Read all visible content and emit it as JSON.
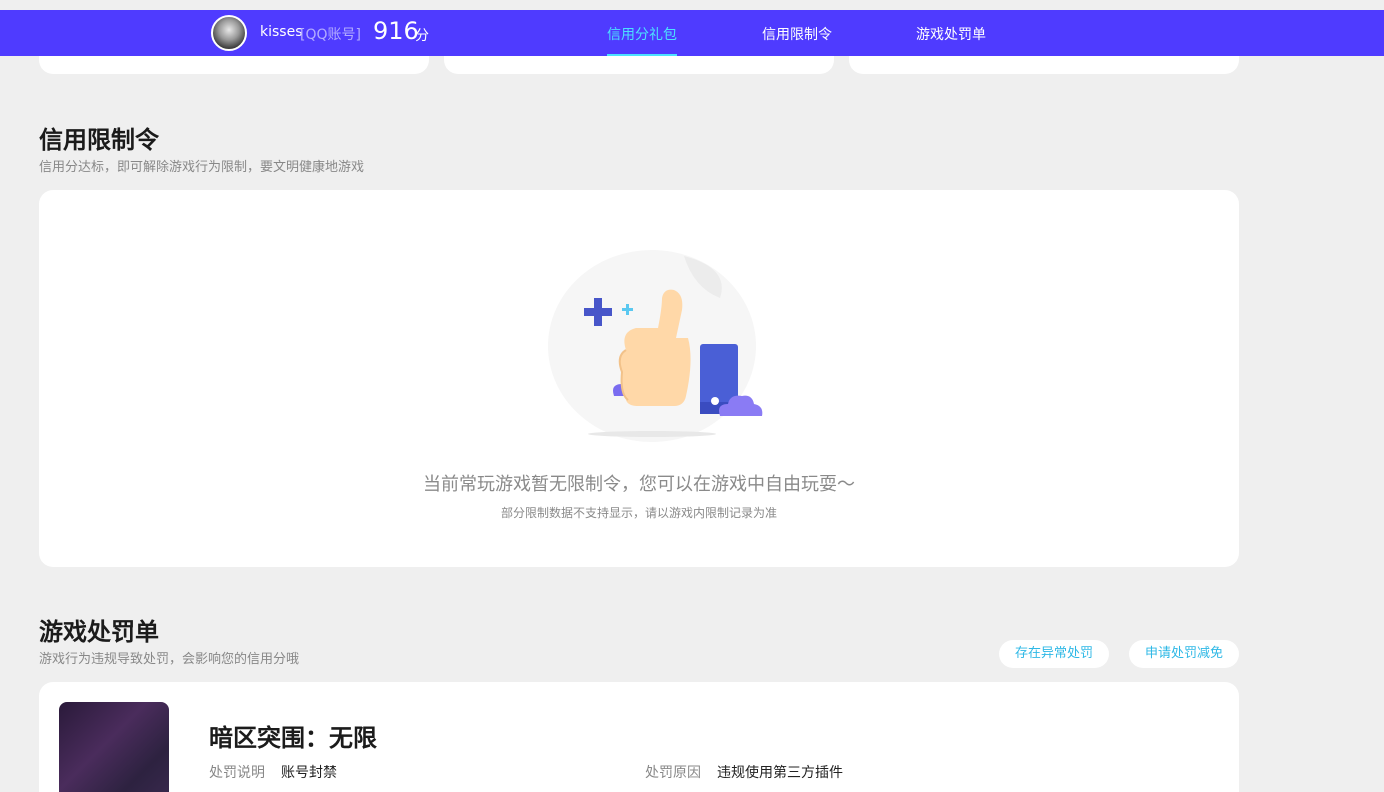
{
  "topbar": {
    "username": "kisses",
    "account_type": "[QQ账号]",
    "score": "916",
    "score_unit": "分",
    "tabs": [
      {
        "label": "信用分礼包",
        "active": true
      },
      {
        "label": "信用限制令",
        "active": false
      },
      {
        "label": "游戏处罚单",
        "active": false
      }
    ],
    "accent": "#4f3bff",
    "active_tab_color": "#4ce1ff"
  },
  "restriction": {
    "title": "信用限制令",
    "subtitle": "信用分达标，即可解除游戏行为限制，要文明健康地游戏",
    "empty_message": "当前常玩游戏暂无限制令，您可以在游戏中自由玩耍～",
    "empty_note": "部分限制数据不支持显示，请以游戏内限制记录为准",
    "illustration_icon": "thumbs-up-icon"
  },
  "penalty": {
    "title": "游戏处罚单",
    "subtitle": "游戏行为违规导致处罚，会影响您的信用分哦",
    "buttons": {
      "abnormal": "存在异常处罚",
      "reduce": "申请处罚减免"
    },
    "items": [
      {
        "game": "暗区突围：无限",
        "desc_label": "处罚说明",
        "desc_value": "账号封禁",
        "reason_label": "处罚原因",
        "reason_value": "违规使用第三方插件"
      }
    ]
  }
}
